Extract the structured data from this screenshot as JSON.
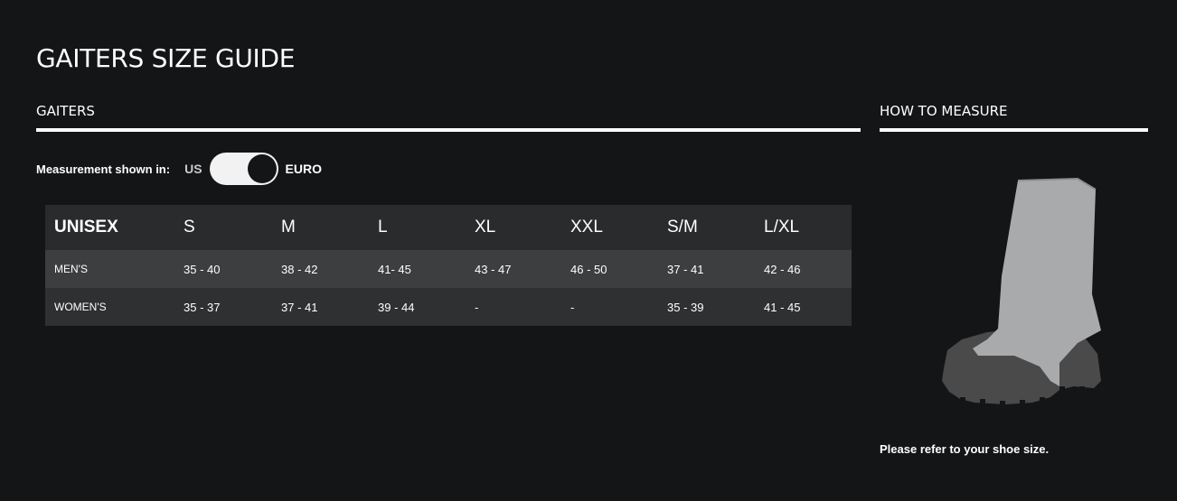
{
  "page_title": "GAITERS SIZE GUIDE",
  "gaiters_section": {
    "heading": "GAITERS",
    "measurement_label": "Measurement shown in:",
    "unit_left": "US",
    "unit_right": "EURO",
    "toggle_selected": "EURO"
  },
  "size_table": {
    "header": [
      "UNISEX",
      "S",
      "M",
      "L",
      "XL",
      "XXL",
      "S/M",
      "L/XL"
    ],
    "rows": [
      {
        "label": "MEN'S",
        "values": [
          "35 - 40",
          "38 - 42",
          "41- 45",
          "43 - 47",
          "46 - 50",
          "37 - 41",
          "42 - 46"
        ]
      },
      {
        "label": "WOMEN'S",
        "values": [
          "35 - 37",
          "37 - 41",
          "39 - 44",
          "-",
          "-",
          "35 - 39",
          "41 - 45"
        ]
      }
    ]
  },
  "how_to_measure": {
    "heading": "HOW TO MEASURE",
    "illustration_icon": "gaiter-boot-illustration",
    "note": "Please refer to your shoe size."
  },
  "colors": {
    "background": "#141517",
    "header_row": "#2a2b2d",
    "men_row": "#3d3e40",
    "women_row": "#2f3032",
    "gaiter": "#a9aaac",
    "boot": "#4a4a4b"
  }
}
